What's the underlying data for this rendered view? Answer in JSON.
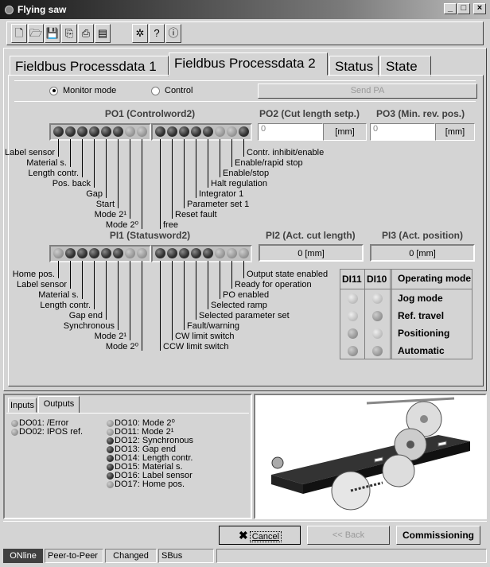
{
  "window": {
    "title": "Flying saw",
    "minimize": "_",
    "maximize": "□",
    "close": "×"
  },
  "toolbar": [
    {
      "name": "new-icon",
      "glyph": "🗋"
    },
    {
      "name": "open-icon",
      "glyph": "🗁"
    },
    {
      "name": "save-icon",
      "glyph": "💾"
    },
    {
      "name": "copy-icon",
      "glyph": "⎘"
    },
    {
      "name": "print-icon",
      "glyph": "⎙"
    },
    {
      "name": "export-icon",
      "glyph": "▤"
    },
    {
      "name": "bug-icon",
      "glyph": "✲"
    },
    {
      "name": "help-icon",
      "glyph": "?"
    },
    {
      "name": "info-icon",
      "glyph": "ⓘ"
    }
  ],
  "tabs": [
    {
      "label": "Fieldbus Processdata 1",
      "active": false
    },
    {
      "label": "Fieldbus Processdata 2",
      "active": true
    },
    {
      "label": "Status",
      "active": false
    },
    {
      "label": "State",
      "active": false
    }
  ],
  "mode": {
    "monitor_label": "Monitor mode",
    "control_label": "Control",
    "selected": "monitor",
    "send_label": "Send PA"
  },
  "po1": {
    "title": "PO1 (Controlword2)",
    "leds": [
      "on",
      "on",
      "on",
      "on",
      "on",
      "on",
      "off",
      "off",
      "on",
      "on",
      "on",
      "on",
      "on",
      "off",
      "off",
      "on"
    ],
    "labels": [
      "Label sensor",
      "Material s.",
      "Length contr.",
      "Pos. back",
      "Gap",
      "Start",
      "Mode 2¹",
      "Mode 2⁰",
      "free",
      "Reset fault",
      "Parameter set 1",
      "Integrator 1",
      "Halt regulation",
      "Enable/stop",
      "Enable/rapid stop",
      "Contr. inhibit/enable"
    ]
  },
  "po2": {
    "title": "PO2 (Cut length setp.)",
    "value": "0",
    "unit": "[mm]"
  },
  "po3": {
    "title": "PO3 (Min. rev. pos.)",
    "value": "0",
    "unit": "[mm]"
  },
  "pi1": {
    "title": "PI1 (Statusword2)",
    "leds": [
      "off",
      "on",
      "on",
      "on",
      "on",
      "on",
      "off",
      "off",
      "on",
      "on",
      "on",
      "on",
      "on",
      "off",
      "off",
      "off"
    ],
    "labels": [
      "Home pos.",
      "Label sensor",
      "Material s.",
      "Length contr.",
      "Gap end",
      "Synchronous",
      "Mode 2¹",
      "Mode 2⁰",
      "CCW limit switch",
      "CW limit switch",
      "Fault/warning",
      "Selected parameter set",
      "Selected ramp",
      "PO enabled",
      "Ready for operation",
      "Output state enabled"
    ]
  },
  "pi2": {
    "title": "PI2 (Act. cut length)",
    "value": "0 [mm]"
  },
  "pi3": {
    "title": "PI3 (Act. position)",
    "value": "0 [mm]"
  },
  "opmode": {
    "headers": [
      "DI11",
      "DI10",
      "Operating mode"
    ],
    "rows": [
      {
        "di11": "pale",
        "di10": "pale",
        "mode": "Jog mode"
      },
      {
        "di11": "pale",
        "di10": "off",
        "mode": "Ref. travel"
      },
      {
        "di11": "off",
        "di10": "pale",
        "mode": "Positioning"
      },
      {
        "di11": "off",
        "di10": "off",
        "mode": "Automatic"
      }
    ]
  },
  "io": {
    "tabs": [
      "Inputs",
      "Outputs"
    ],
    "active_tab": "Outputs",
    "col1": [
      {
        "state": "off",
        "label": "DO01: /Error"
      },
      {
        "state": "off",
        "label": "DO02: IPOS ref."
      }
    ],
    "col2": [
      {
        "state": "off",
        "label": "DO10: Mode 2⁰"
      },
      {
        "state": "off",
        "label": "DO11: Mode 2¹"
      },
      {
        "state": "on",
        "label": "DO12: Synchronous"
      },
      {
        "state": "on",
        "label": "DO13: Gap end"
      },
      {
        "state": "on",
        "label": "DO14: Length contr."
      },
      {
        "state": "on",
        "label": "DO15: Material s."
      },
      {
        "state": "on",
        "label": "DO16: Label sensor"
      },
      {
        "state": "off",
        "label": "DO17: Home pos."
      }
    ]
  },
  "buttons": {
    "cancel": "Cancel",
    "back": "<< Back",
    "commissioning": "Commissioning"
  },
  "status": [
    "ONline",
    "Peer-to-Peer",
    "Changed",
    "SBus"
  ]
}
